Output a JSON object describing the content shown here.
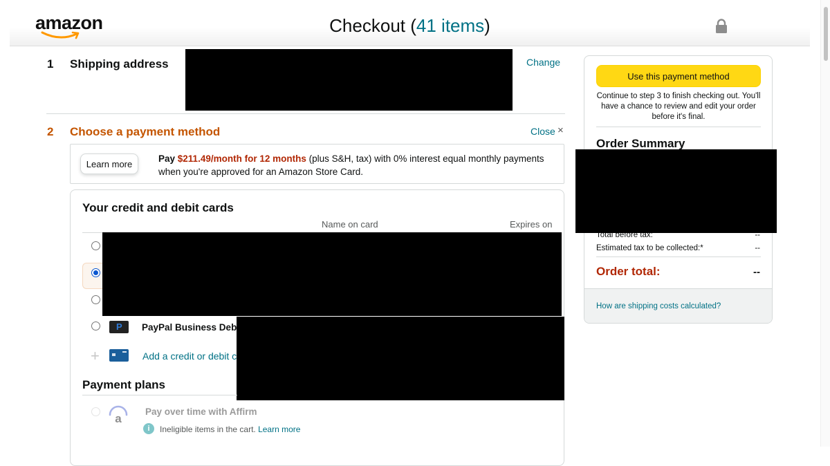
{
  "header": {
    "logo_text": "amazon",
    "title": "Checkout",
    "items_open": "(",
    "items_count": "41 items",
    "items_close": ")"
  },
  "shipping": {
    "step_number": "1",
    "title": "Shipping address",
    "change_link": "Change"
  },
  "payment": {
    "step_number": "2",
    "title": "Choose a payment method",
    "close_link": "Close",
    "close_icon": "×",
    "promo": {
      "button_label": "Learn more",
      "text_prefix": "Pay ",
      "amount": "$211.49/month for 12 months",
      "text_suffix": " (plus S&H, tax) with 0% interest equal monthly payments when you're approved for an Amazon Store Card."
    },
    "cards_section": {
      "title": "Your credit and debit cards",
      "col_name": "Name on card",
      "col_expires": "Expires on",
      "paypal_label": "PayPal Business Debit",
      "add_card_link": "Add a credit or debit ca",
      "selected_index": 1
    },
    "payment_plans": {
      "title": "Payment plans",
      "affirm_label": "Pay over time with Affirm",
      "ineligible_text": "Ineligible items in the cart. ",
      "ineligible_link": "Learn more"
    }
  },
  "summary": {
    "use_button": "Use this payment method",
    "continue_text": "Continue to step 3 to finish checking out. You'll have a chance to review and edit your order before it's final.",
    "order_summary_title": "Order Summary",
    "total_before_tax_label": "Total before tax:",
    "total_before_tax_value": "--",
    "est_tax_label": "Estimated tax to be collected:*",
    "est_tax_value": "--",
    "order_total_label": "Order total:",
    "order_total_value": "--",
    "shipping_costs_link": "How are shipping costs calculated?"
  },
  "colors": {
    "link": "#007185",
    "active_step": "#c45500",
    "price": "#b12704",
    "button_yellow": "#ffd814"
  }
}
